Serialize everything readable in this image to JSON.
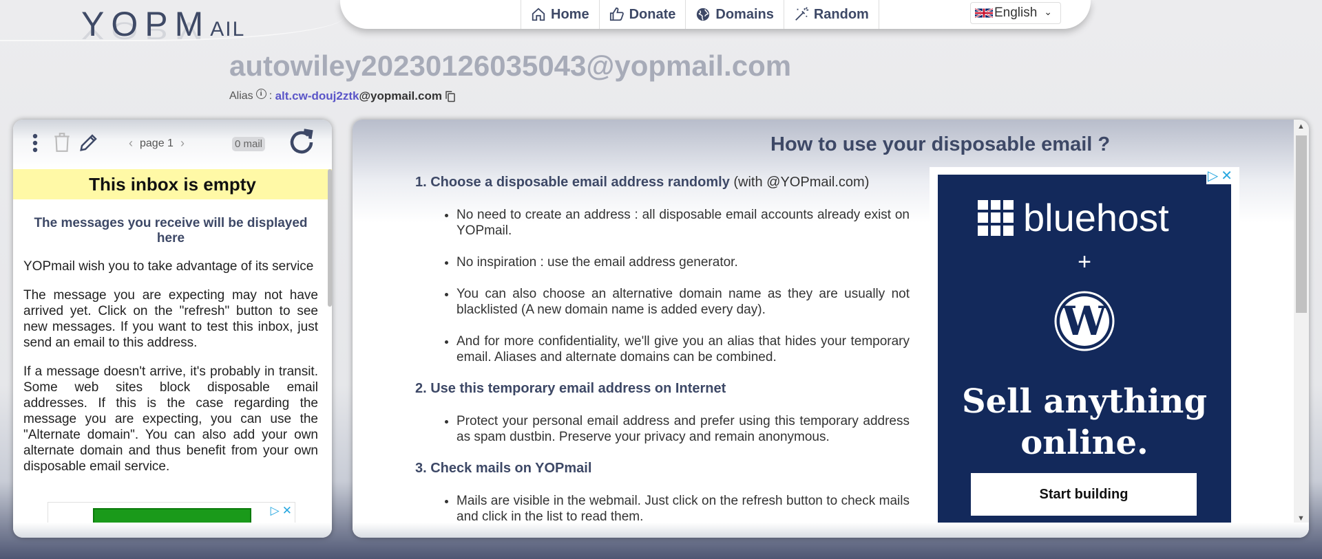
{
  "header": {
    "logo_text": "YOPMAIL",
    "nav": [
      {
        "label": "Home",
        "icon": "home-icon"
      },
      {
        "label": "Donate",
        "icon": "thumbs-up-icon"
      },
      {
        "label": "Domains",
        "icon": "globe-icon"
      },
      {
        "label": "Random",
        "icon": "magic-wand-icon"
      }
    ],
    "language": "English"
  },
  "address": "autowiley20230126035043@yopmail.com",
  "alias": {
    "label": "Alias",
    "separator": ":",
    "prefix": "alt.cw-douj2ztk",
    "domain": "@yopmail.com"
  },
  "inbox": {
    "page_label": "page 1",
    "mail_count": "0 mail",
    "empty_banner": "This inbox is empty",
    "subtitle": "The messages you receive will be displayed here",
    "paragraphs": [
      "YOPmail wish you to take advantage of its service",
      "The message you are expecting may not have arrived yet. Click on the \"refresh\" button to see new messages. If you want to test this inbox, just send an email to this address.",
      "If a message doesn't arrive, it's probably in transit. Some web sites block disposable email addresses. If this is the case regarding the message you are expecting, you can use the \"Alternate domain\". You can also add your own alternate domain and thus benefit from your own disposable email service."
    ]
  },
  "help": {
    "title": "How to use your disposable email ?",
    "steps": [
      {
        "heading": "1. Choose a disposable email address randomly",
        "suffix": " (with @YOPmail.com)",
        "items": [
          "No need to create an address : all disposable email accounts already exist on YOPmail.",
          "No inspiration : use the email address generator.",
          "You can also choose an alternative domain name as they are usually not blacklisted (A new domain name is added every day).",
          "And for more confidentiality, we'll give you an alias that hides your temporary email. Aliases and alternate domains can be combined."
        ]
      },
      {
        "heading": "2. Use this temporary email address on Internet",
        "suffix": "",
        "items": [
          "Protect your personal email address and prefer using this temporary address as spam dustbin. Preserve your privacy and remain anonymous."
        ]
      },
      {
        "heading": "3. Check mails on YOPmail",
        "suffix": "",
        "items": [
          "Mails are visible in the webmail. Just click on the refresh button to check mails and click in the list to read them."
        ]
      }
    ]
  },
  "ad": {
    "brand": "bluehost",
    "plus": "+",
    "headline": "Sell anything online.",
    "cta": "Start building",
    "bg_color": "#13295b"
  },
  "colors": {
    "accent": "#3d4866",
    "empty_banner": "#fff9a6",
    "alias_link": "#5a55c8"
  }
}
